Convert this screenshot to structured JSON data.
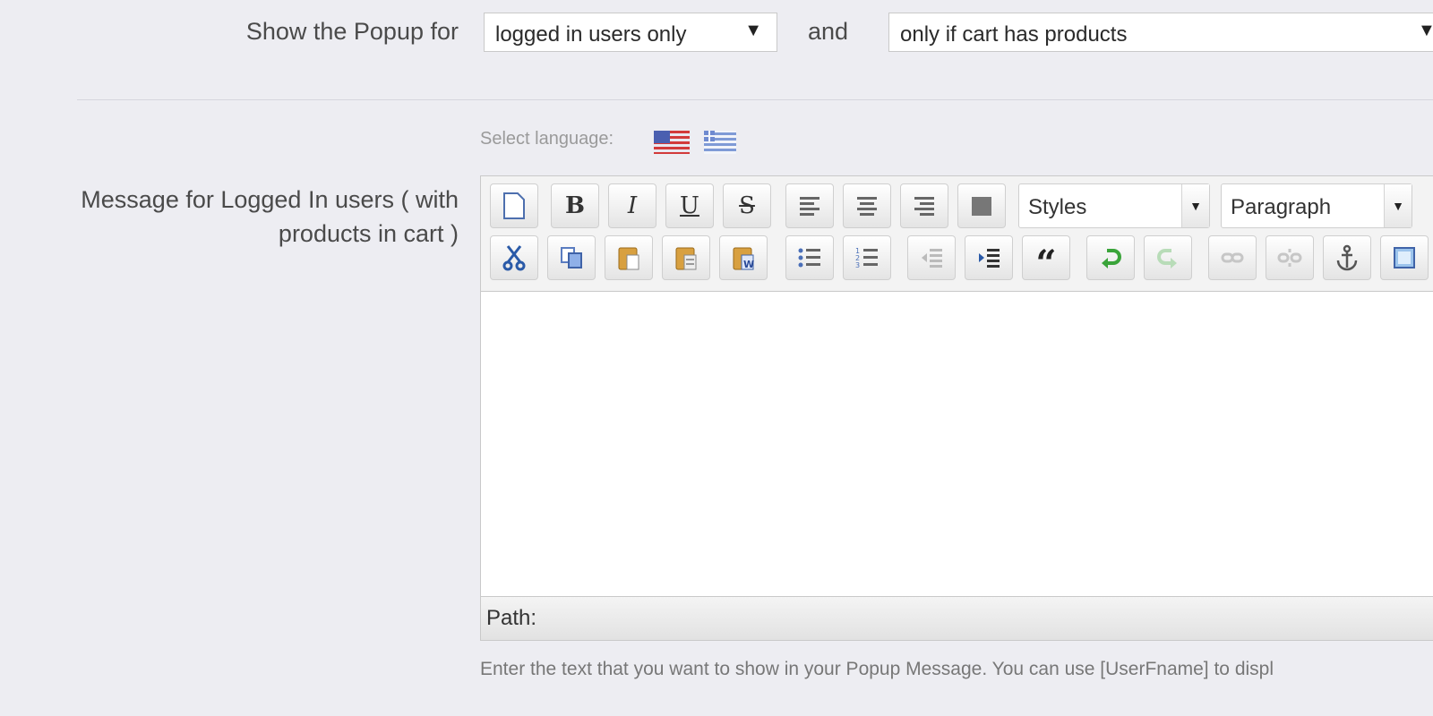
{
  "show_popup": {
    "label": "Show the Popup for",
    "users_select_value": "logged in users only",
    "and_label": "and",
    "cart_select_value": "only if cart has products"
  },
  "language": {
    "label": "Select language:",
    "flags": [
      "flag-us-icon",
      "flag-gr-icon"
    ]
  },
  "message": {
    "label_line1": "Message for Logged In users ( with",
    "label_line2": "products in cart )"
  },
  "editor": {
    "styles_value": "Styles",
    "format_value": "Paragraph",
    "path_label": "Path:",
    "toolbar_row1": [
      "new-document-icon",
      "bold-icon",
      "italic-icon",
      "underline-icon",
      "strikethrough-icon",
      "align-left-icon",
      "align-center-icon",
      "align-right-icon",
      "align-justify-icon"
    ],
    "toolbar_row2": [
      "cut-icon",
      "copy-icon",
      "paste-icon",
      "paste-text-icon",
      "paste-word-icon",
      "bullet-list-icon",
      "numbered-list-icon",
      "outdent-icon",
      "indent-icon",
      "blockquote-icon",
      "undo-icon",
      "redo-icon",
      "link-icon",
      "unlink-icon",
      "anchor-icon",
      "image-icon"
    ]
  },
  "help_text": "Enter the text that you want to show in your Popup Message. You can use [UserFname] to displ",
  "colors": {
    "background": "#ededf2",
    "label": "#4a4a4a",
    "undo_green": "#3aa43a"
  }
}
